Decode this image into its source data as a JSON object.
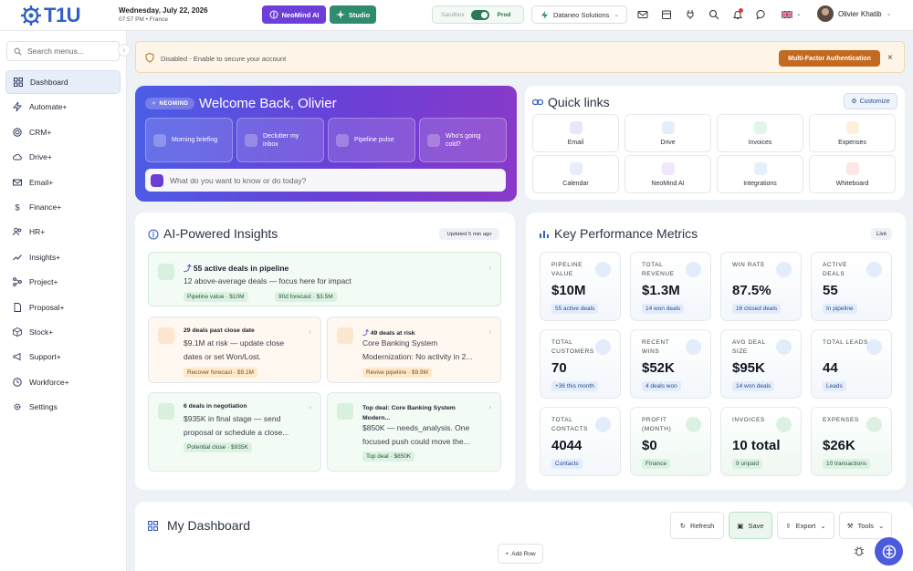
{
  "header": {
    "logo": "T1U",
    "date": "Wednesday, July 22, 2026",
    "time_location": "07:57 PM • France",
    "neomind_label": "NeoMind AI",
    "studio_label": "Studio",
    "env_sandbox": "Sandbox",
    "env_prod": "Prod",
    "company": "Dataneo Solutions",
    "user_name": "Olivier Khatib"
  },
  "sidebar": {
    "search_placeholder": "Search menus...",
    "items": [
      {
        "label": "Dashboard"
      },
      {
        "label": "Automate+"
      },
      {
        "label": "CRM+"
      },
      {
        "label": "Drive+"
      },
      {
        "label": "Email+"
      },
      {
        "label": "Finance+"
      },
      {
        "label": "HR+"
      },
      {
        "label": "Insights+"
      },
      {
        "label": "Project+"
      },
      {
        "label": "Proposal+"
      },
      {
        "label": "Stock+"
      },
      {
        "label": "Support+"
      },
      {
        "label": "Workforce+"
      },
      {
        "label": "Settings"
      }
    ]
  },
  "alert": {
    "text": "Disabled - Enable to secure your account",
    "button": "Multi-Factor Authentication",
    "close": "×"
  },
  "welcome": {
    "badge": "NEOMIND",
    "title": "Welcome Back, Olivier",
    "cards": [
      {
        "label": "Morning briefing"
      },
      {
        "label": "Declutter my inbox"
      },
      {
        "label": "Pipeline pulse"
      },
      {
        "label": "Who's going cold?"
      }
    ],
    "prompt_placeholder": "What do you want to know or do today?"
  },
  "quick_links": {
    "title": "Quick links",
    "customize": "Customize",
    "items": [
      {
        "label": "Email",
        "color": "#e9e6fb"
      },
      {
        "label": "Drive",
        "color": "#e6eefb"
      },
      {
        "label": "Invoices",
        "color": "#e3f5e8"
      },
      {
        "label": "Expenses",
        "color": "#fdf0dc"
      },
      {
        "label": "Calendar",
        "color": "#e6eefb"
      },
      {
        "label": "NeoMind AI",
        "color": "#f1e6fb"
      },
      {
        "label": "Integrations",
        "color": "#e4f1fb"
      },
      {
        "label": "Whiteboard",
        "color": "#fde6e6"
      }
    ]
  },
  "insights": {
    "title": "AI-Powered Insights",
    "updated": "Updated 5 min ago",
    "top": {
      "title": "55 active deals in pipeline",
      "body": "12 above-average deals — focus here for impact",
      "tag1": "Pipeline value · $10M",
      "tag2": "90d forecast · $3.5M"
    },
    "cards": [
      {
        "title": "29 deals past close date",
        "body1": "$9.1M at risk — update close",
        "body2": "dates or set Won/Lost.",
        "tag": "Recover forecast · $9.1M"
      },
      {
        "title": "49 deals at risk",
        "body1": "Core Banking System",
        "body2": "Modernization: No activity in 2...",
        "tag": "Revive pipeline · $9.9M"
      },
      {
        "title": "6 deals in negotiation",
        "body1": "$935K in final stage — send",
        "body2": "proposal or schedule a close...",
        "tag": "Potential close · $935K"
      },
      {
        "title": "Top deal: Core Banking System",
        "title2": "Modern...",
        "body1": "$850K — needs_analysis. One",
        "body2": "focused push could move the...",
        "tag": "Top deal · $850K"
      }
    ]
  },
  "kpi": {
    "title": "Key Performance Metrics",
    "live": "Live",
    "cards": [
      {
        "label": "Pipeline Value",
        "value": "$10M",
        "sub": "55 active deals",
        "tone": "blue"
      },
      {
        "label": "Total Revenue",
        "value": "$1.3M",
        "sub": "14 won deals",
        "tone": "blue"
      },
      {
        "label": "Win Rate",
        "value": "87.5%",
        "sub": "16 closed deals",
        "tone": "blue"
      },
      {
        "label": "Active Deals",
        "value": "55",
        "sub": "In pipeline",
        "tone": "blue"
      },
      {
        "label": "Total Customers",
        "value": "70",
        "sub": "+36 this month",
        "tone": "blue"
      },
      {
        "label": "Recent Wins",
        "value": "$52K",
        "sub": "4 deals won",
        "tone": "blue"
      },
      {
        "label": "Avg Deal Size",
        "value": "$95K",
        "sub": "14 won deals",
        "tone": "blue"
      },
      {
        "label": "Total Leads",
        "value": "44",
        "sub": "Leads",
        "tone": "blue"
      },
      {
        "label": "Total Contacts",
        "value": "4044",
        "sub": "Contacts",
        "tone": "blue"
      },
      {
        "label": "Profit (Month)",
        "value": "$0",
        "sub": "Finance",
        "tone": "green"
      },
      {
        "label": "Invoices",
        "value": "10 total",
        "sub": "9 unpaid",
        "tone": "green"
      },
      {
        "label": "Expenses",
        "value": "$26K",
        "sub": "10 transactions",
        "tone": "green"
      }
    ]
  },
  "my_dashboard": {
    "title": "My Dashboard",
    "refresh": "Refresh",
    "save": "Save",
    "export": "Export",
    "tools": "Tools",
    "add_row": "Add Row"
  }
}
